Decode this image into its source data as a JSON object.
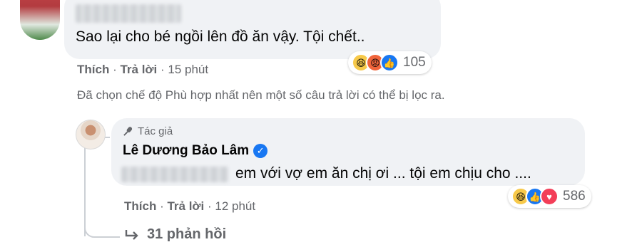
{
  "comment1": {
    "text": "Sao lại cho bé ngồi lên đồ ăn vậy. Tội chết..",
    "reaction_count": "105",
    "reactions": [
      "haha-icon",
      "angry-icon",
      "like-icon"
    ],
    "like_label": "Thích",
    "reply_label": "Trả lời",
    "time": "15 phút"
  },
  "filter_note": "Đã chọn chế độ Phù hợp nhất nên một số câu trả lời có thể bị lọc ra.",
  "reply": {
    "author_tag": "Tác giả",
    "author_name": "Lê Dương Bảo Lâm",
    "text": "em với vợ em ăn chị ơi ... tội em chịu cho ....",
    "reaction_count": "586",
    "reactions": [
      "haha-icon",
      "like-icon",
      "love-icon"
    ],
    "like_label": "Thích",
    "reply_label": "Trả lời",
    "time": "12 phút"
  },
  "more_replies": "31 phản hồi",
  "colors": {
    "bubble_bg": "#f0f2f5",
    "secondary_text": "#65676b",
    "verified_blue": "#1877f2"
  }
}
